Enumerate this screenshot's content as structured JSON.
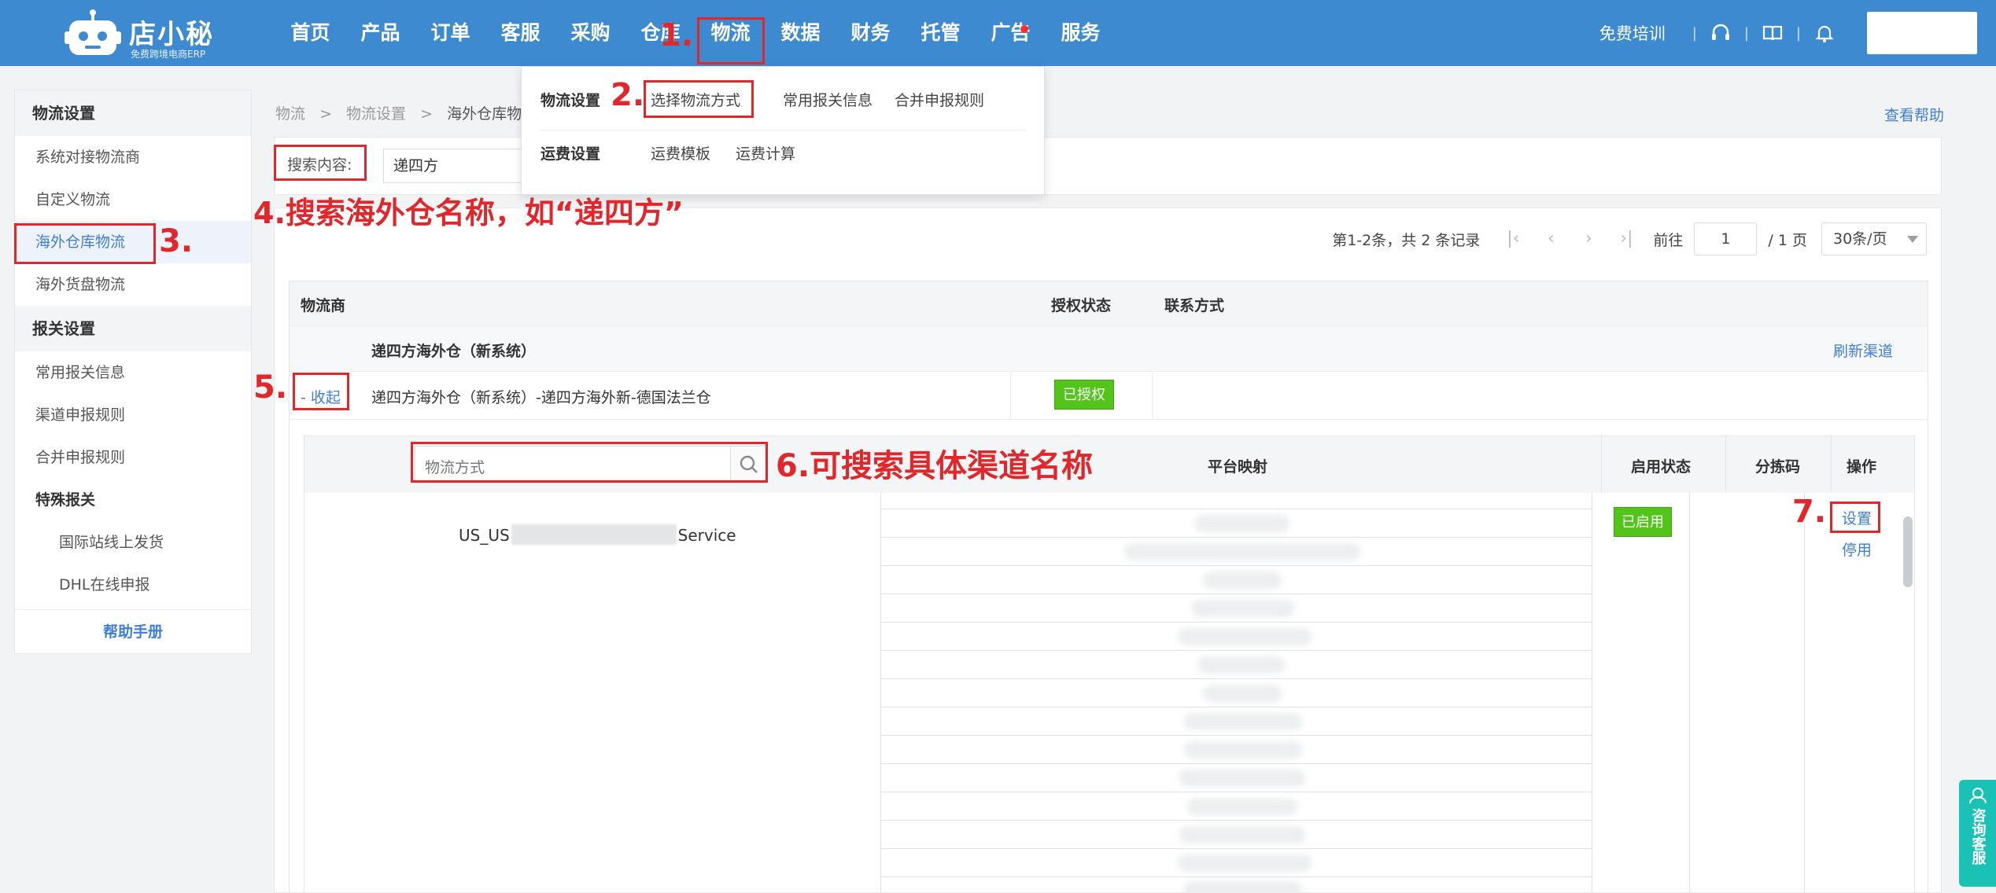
{
  "brand": {
    "title": "店小秘",
    "subtitle": "免费跨境电商ERP"
  },
  "nav": {
    "items": [
      "首页",
      "产品",
      "订单",
      "客服",
      "采购",
      "仓库",
      "物流",
      "数据",
      "财务",
      "托管",
      "广告",
      "服务"
    ],
    "active": "物流"
  },
  "topbar": {
    "free_training": "免费培训",
    "separator": "|"
  },
  "dropdown": {
    "logistics_settings": "物流设置",
    "select_method": "选择物流方式",
    "customs_info": "常用报关信息",
    "merge_rules": "合并申报规则",
    "freight_settings": "运费设置",
    "freight_template": "运费模板",
    "freight_calc": "运费计算"
  },
  "sidebar": {
    "group1": "物流设置",
    "item_system": "系统对接物流商",
    "item_custom": "自定义物流",
    "item_overseas": "海外仓库物流",
    "item_stock": "海外货盘物流",
    "group2": "报关设置",
    "item_customs": "常用报关信息",
    "item_channel_rules": "渠道申报规则",
    "item_merge": "合并申报规则",
    "item_special": "特殊报关",
    "item_intl": "国际站线上发货",
    "item_dhl": "DHL在线申报",
    "help": "帮助手册"
  },
  "breadcrumb": {
    "a": "物流",
    "b": "物流设置",
    "c": "海外仓库物流",
    "arrow": ">"
  },
  "help_link": "查看帮助",
  "search": {
    "label": "搜索内容:",
    "value": "递四方"
  },
  "pager": {
    "summary": "第1-2条，共 2 条记录",
    "goto": "前往",
    "page": "1",
    "total": "/ 1 页",
    "size": "30条/页"
  },
  "table": {
    "col_provider": "物流商",
    "col_auth": "授权状态",
    "col_contact": "联系方式",
    "group_name": "递四方海外仓（新系统）",
    "refresh": "刷新渠道",
    "collapse": "- 收起",
    "row_name": "递四方海外仓（新系统）-递四方海外新-德国法兰仓",
    "auth_status": "已授权"
  },
  "sub_table": {
    "search_placeholder": "物流方式",
    "col_mapping": "平台映射",
    "col_enabled": "启用状态",
    "col_sort": "分拣码",
    "col_ops": "操作",
    "channel_prefix": "US_US",
    "channel_suffix": "Service",
    "enabled": "已启用",
    "op_set": "设置",
    "op_stop": "停用"
  },
  "annotations": {
    "a1": "1.",
    "a2": "2.",
    "a3": "3.",
    "a4": "4.搜索海外仓名称，如“递四方”",
    "a5": "5.",
    "a6": "6.可搜索具体渠道名称",
    "a7": "7."
  },
  "float_service": "咨询客服",
  "colors": {
    "primary": "#3e8ad0",
    "annotation": "#e0282c",
    "success": "#52c41a",
    "link": "#3f7ed8"
  }
}
